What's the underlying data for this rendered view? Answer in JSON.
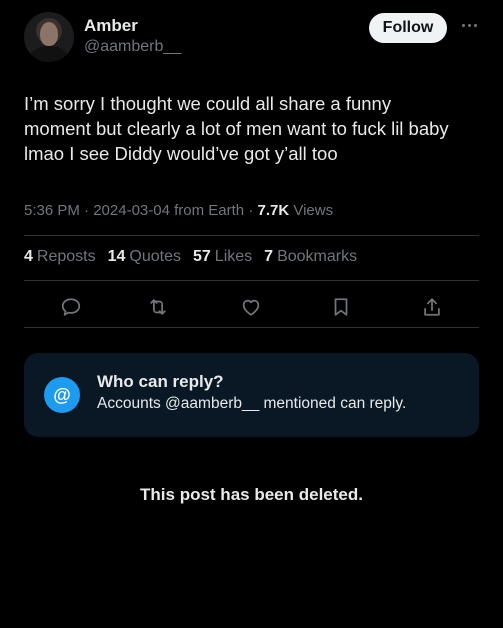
{
  "author": {
    "name": "Amber",
    "handle": "@aamberb__",
    "follow_label": "Follow",
    "more_icon": "more-horizontal-icon"
  },
  "tweet": {
    "lines": [
      "I’m sorry I thought we could all share a funny",
      "moment but clearly a lot of men want to fuck lil baby",
      "lmao I see Diddy would’ve got y’all too"
    ],
    "time": "5:36 PM",
    "date": "2024-03-04",
    "source": "from Earth",
    "views_count": "7.7K",
    "views_label": "Views"
  },
  "stats": {
    "reposts_count": "4",
    "reposts_label": "Reposts",
    "quotes_count": "14",
    "quotes_label": "Quotes",
    "likes_count": "57",
    "likes_label": "Likes",
    "bookmarks_count": "7",
    "bookmarks_label": "Bookmarks"
  },
  "actions": [
    "reply-icon",
    "repost-icon",
    "like-icon",
    "bookmark-icon",
    "share-icon"
  ],
  "reply_restriction": {
    "icon_glyph": "@",
    "title": "Who can reply?",
    "description": "Accounts @aamberb__ mentioned can reply."
  },
  "footer": {
    "deleted_notice": "This post has been deleted."
  },
  "colors": {
    "background": "#000000",
    "text": "#e7e9ea",
    "muted": "#71767b",
    "accent": "#1d9bf0",
    "card": "#0a1724"
  }
}
